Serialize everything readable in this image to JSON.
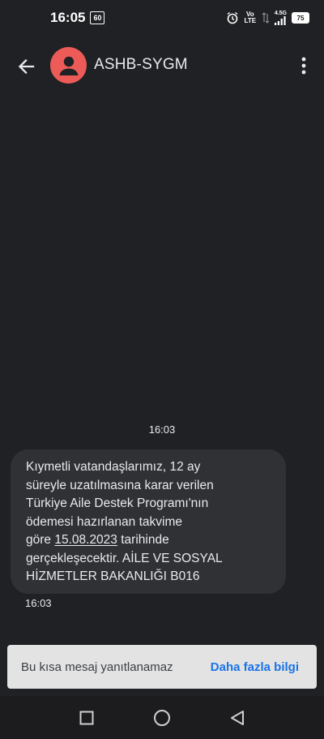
{
  "status_bar": {
    "time": "16:05",
    "data_badge": "60",
    "network": "4.5G",
    "volte": "Vo LTE",
    "battery": "75"
  },
  "header": {
    "contact_name": "ASHB-SYGM",
    "back_icon": "arrow-back-icon",
    "more_icon": "more-vert-icon",
    "avatar_icon": "person-icon",
    "avatar_color": "#ec5b57"
  },
  "conversation": {
    "thread_time": "16:03",
    "message": {
      "line1": "Kıymetli vatandaşlarımız, 12 ay",
      "line2": "süreyle uzatılmasına karar verilen",
      "line3": "Türkiye Aile Destek Programı'nın",
      "line4": "ödemesi hazırlanan takvime",
      "line5_before": "göre ",
      "line5_date": "15.08.2023",
      "line5_after": " tarihinde",
      "line6": "gerçekleşecektir. AİLE VE SOSYAL",
      "line7": "HİZMETLER BAKANLIĞI B016"
    },
    "message_time": "16:03"
  },
  "footer": {
    "notice": "Bu kısa mesaj yanıtlanamaz",
    "link": "Daha fazla bilgi",
    "link_color": "#1a73e8"
  },
  "nav_bar": {
    "recent_icon": "square-icon",
    "home_icon": "circle-icon",
    "back_icon": "triangle-back-icon"
  }
}
